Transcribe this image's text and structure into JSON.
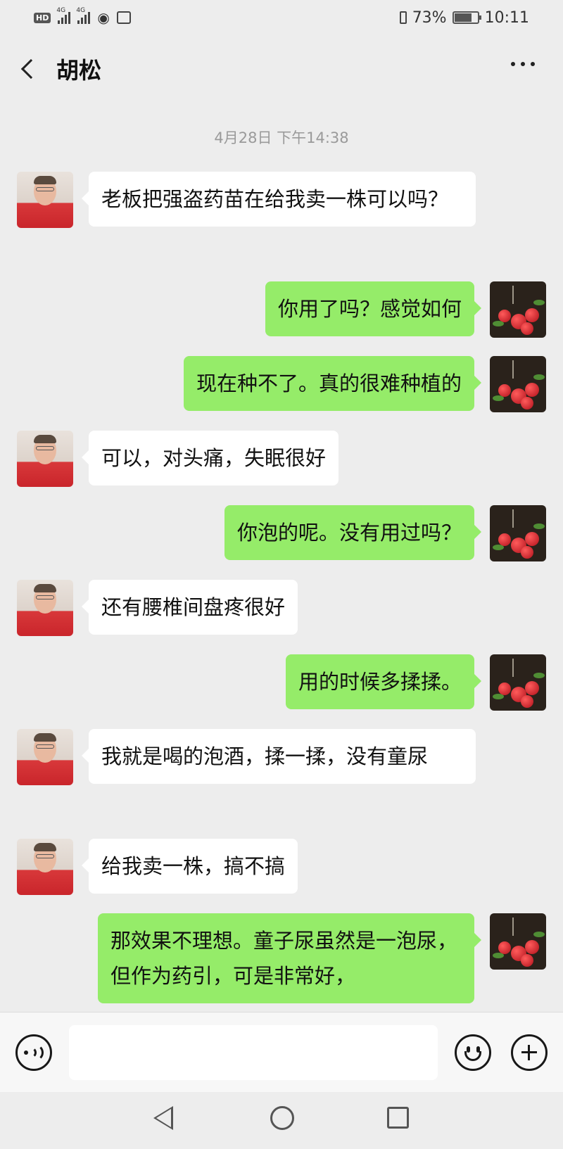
{
  "status_bar": {
    "hd_badge": "HD",
    "sim1": "4G",
    "sim2": "4G",
    "battery_text": "73%",
    "battery_level": 0.73,
    "time": "10:11"
  },
  "header": {
    "title": "胡松"
  },
  "timestamp": "4月28日 下午14:38",
  "messages": [
    {
      "side": "left",
      "text": "老板把强盗药苗在给我卖一株可以吗？"
    },
    {
      "side": "right",
      "text": "你用了吗？感觉如何"
    },
    {
      "side": "right",
      "text": "现在种不了。真的很难种植的"
    },
    {
      "side": "left",
      "text": "可以，对头痛，失眠很好"
    },
    {
      "side": "right",
      "text": "你泡的呢。没有用过吗？"
    },
    {
      "side": "left",
      "text": "还有腰椎间盘疼很好"
    },
    {
      "side": "right",
      "text": "用的时候多揉揉。"
    },
    {
      "side": "left",
      "text": "我就是喝的泡酒，揉一揉，没有童尿"
    },
    {
      "side": "left",
      "text": "给我卖一株，搞不搞"
    },
    {
      "side": "right",
      "text": "那效果不理想。童子尿虽然是一泡尿，但作为药引，可是非常好，"
    }
  ],
  "input_bar": {
    "value": "",
    "icons": [
      "voice-icon",
      "emoji-icon",
      "plus-icon"
    ]
  },
  "colors": {
    "background": "#ededed",
    "sent_bubble": "#95ec69",
    "received_bubble": "#ffffff"
  }
}
